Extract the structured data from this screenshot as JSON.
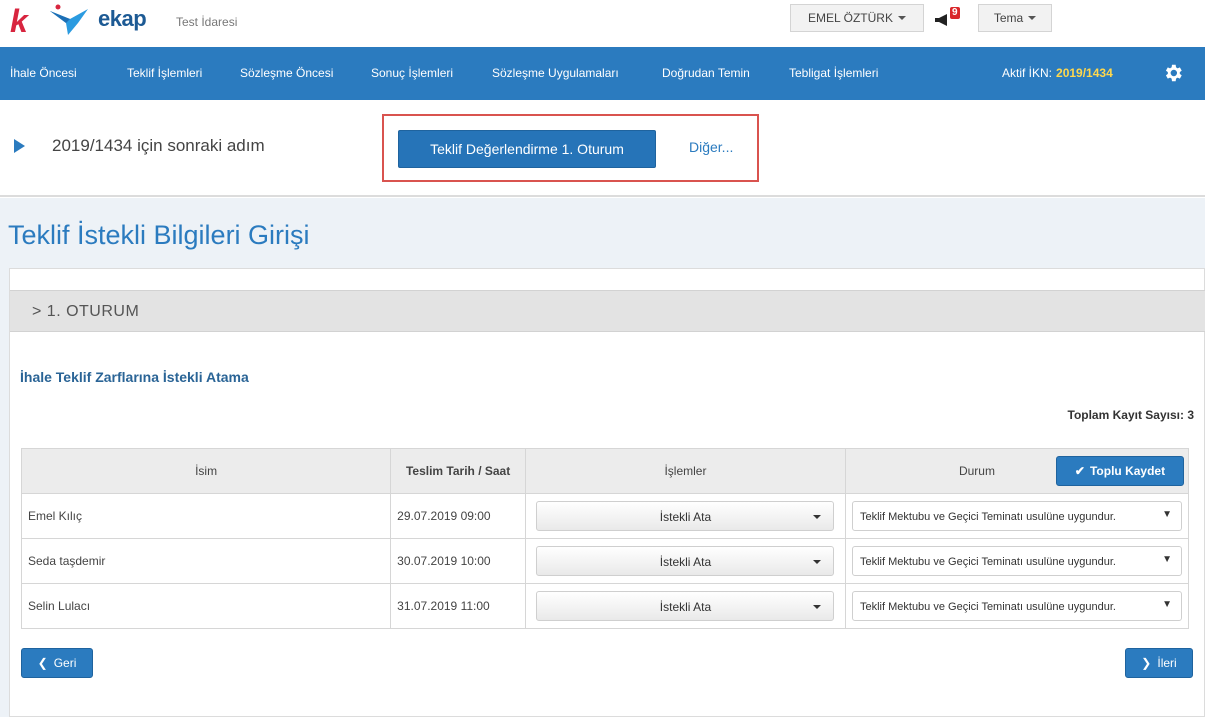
{
  "header": {
    "logo_letter": "k",
    "logo_text": "ekap",
    "org_name": "Test İdaresi",
    "user_name": "EMEL ÖZTÜRK",
    "notification_count": "9",
    "theme_label": "Tema"
  },
  "nav": {
    "items": [
      {
        "label": "İhale Öncesi"
      },
      {
        "label": "Teklif İşlemleri"
      },
      {
        "label": "Sözleşme Öncesi"
      },
      {
        "label": "Sonuç İşlemleri"
      },
      {
        "label": "Sözleşme Uygulamaları"
      },
      {
        "label": "Doğrudan Temin"
      },
      {
        "label": "Tebligat İşlemleri"
      }
    ],
    "active_ikn_label": "Aktif İKN:",
    "active_ikn_value": "2019/1434"
  },
  "next_step": {
    "text": "2019/1434 için sonraki adım",
    "primary_button": "Teklif Değerlendirme 1. Oturum",
    "other_link": "Diğer..."
  },
  "page": {
    "title": "Teklif İstekli Bilgileri Girişi",
    "session_label": "> 1. OTURUM",
    "section_title": "İhale Teklif Zarflarına İstekli Atama",
    "total_records": "Toplam Kayıt Sayısı: 3"
  },
  "table": {
    "headers": {
      "name": "İsim",
      "delivery": "Teslim Tarih / Saat",
      "actions": "İşlemler",
      "status": "Durum"
    },
    "bulk_save": "Toplu Kaydet",
    "rows": [
      {
        "name": "Emel Kılıç",
        "delivery": "29.07.2019 09:00",
        "action": "İstekli Ata",
        "status": "Teklif Mektubu ve Geçici Teminatı usulüne uygundur."
      },
      {
        "name": "Seda taşdemir",
        "delivery": "30.07.2019 10:00",
        "action": "İstekli Ata",
        "status": "Teklif Mektubu ve Geçici Teminatı usulüne uygundur."
      },
      {
        "name": "Selin Lulacı",
        "delivery": "31.07.2019 11:00",
        "action": "İstekli Ata",
        "status": "Teklif Mektubu ve Geçici Teminatı usulüne uygundur."
      }
    ]
  },
  "footer": {
    "back_label": "Geri",
    "next_label": "İleri"
  },
  "colors": {
    "primary": "#2b7bbf",
    "accent_yellow": "#ffd84d",
    "highlight_red": "#d9534f"
  }
}
